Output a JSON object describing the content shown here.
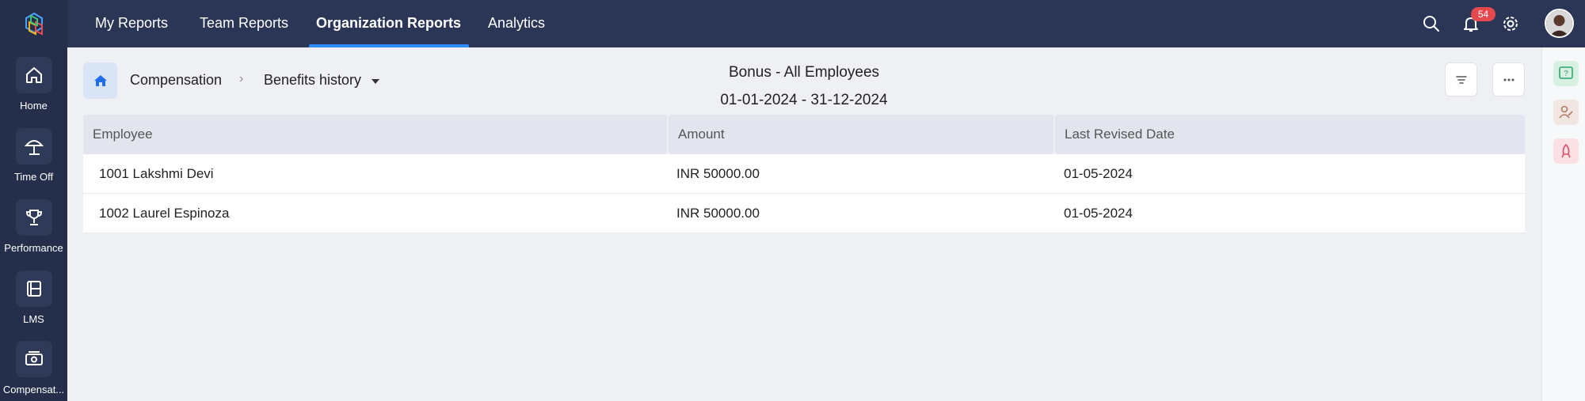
{
  "sidebar": {
    "items": [
      {
        "label": "Home",
        "icon": "home-icon"
      },
      {
        "label": "Time Off",
        "icon": "beach-umbrella-icon"
      },
      {
        "label": "Performance",
        "icon": "trophy-icon"
      },
      {
        "label": "LMS",
        "icon": "learning-icon"
      },
      {
        "label": "Compensat...",
        "icon": "compensation-icon"
      }
    ]
  },
  "nav": {
    "tabs": [
      {
        "label": "My Reports"
      },
      {
        "label": "Team Reports"
      },
      {
        "label": "Organization Reports",
        "active": true
      },
      {
        "label": "Analytics"
      }
    ],
    "notification_count": "54"
  },
  "breadcrumb": {
    "section": "Compensation",
    "separator": "›",
    "current": "Benefits history"
  },
  "report": {
    "title": "Bonus - All Employees",
    "date_range": "01-01-2024 - 31-12-2024"
  },
  "table": {
    "columns": [
      "Employee",
      "Amount",
      "Last Revised Date"
    ],
    "rows": [
      {
        "employee": "1001 Lakshmi Devi",
        "amount": "INR 50000.00",
        "date": "01-05-2024"
      },
      {
        "employee": "1002 Laurel Espinoza",
        "amount": "INR 50000.00",
        "date": "01-05-2024"
      }
    ]
  },
  "colors": {
    "sidebar_bg": "#252f4c",
    "topbar_bg": "#2b3656",
    "accent": "#2f8bff",
    "badge": "#e5484d"
  }
}
